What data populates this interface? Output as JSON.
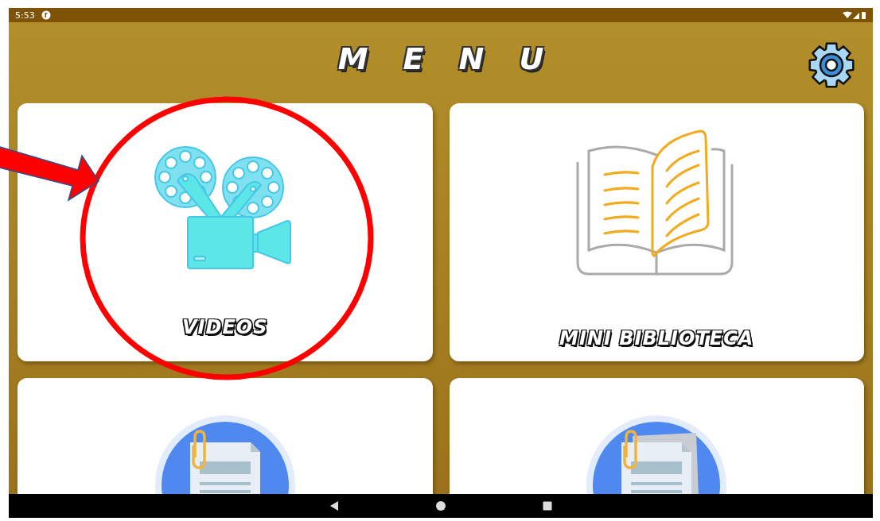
{
  "status_bar": {
    "time": "5:53"
  },
  "header": {
    "title_letters": [
      "M",
      "E",
      "N",
      "U"
    ]
  },
  "cards": [
    {
      "kind": "video",
      "label": "VIDEOS"
    },
    {
      "kind": "book",
      "label": "MINI BIBLIOTECA"
    },
    {
      "kind": "document"
    },
    {
      "kind": "document-stack"
    }
  ]
}
